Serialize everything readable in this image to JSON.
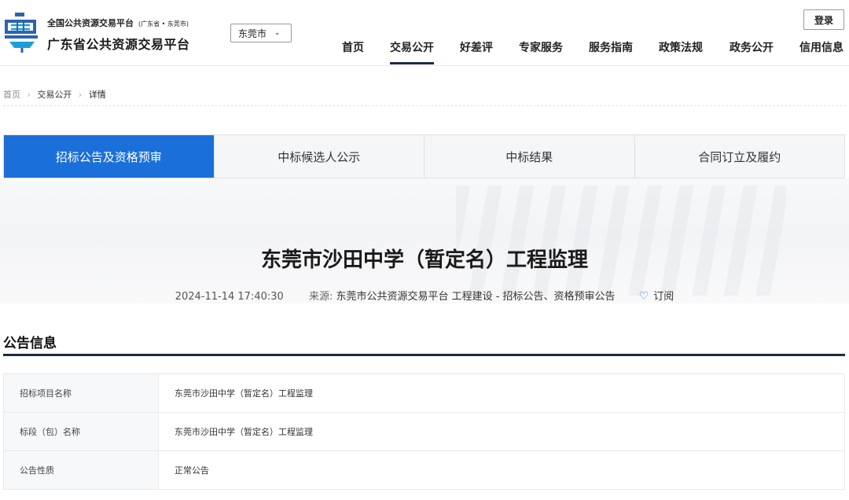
{
  "header": {
    "brand_top": "全国公共资源交易平台",
    "brand_top_sub": "(广东省 • 东莞市)",
    "brand_main": "广东省公共资源交易平台",
    "city_select": "东莞市",
    "login_label": "登录",
    "nav": [
      "首页",
      "交易公开",
      "好差评",
      "专家服务",
      "服务指南",
      "政策法规",
      "政务公开",
      "信用信息"
    ],
    "nav_active": "交易公开"
  },
  "breadcrumb": [
    "首页",
    "交易公开",
    "详情"
  ],
  "tabs": [
    "招标公告及资格预审",
    "中标候选人公示",
    "中标结果",
    "合同订立及履约"
  ],
  "tabs_active": "招标公告及资格预审",
  "article": {
    "title": "东莞市沙田中学（暂定名）工程监理",
    "datetime": "2024-11-14 17:40:30",
    "source_label": "来源:",
    "source": "东莞市公共资源交易平台 工程建设 - 招标公告、资格预审公告",
    "subscribe_label": "订阅"
  },
  "section": {
    "title": "公告信息",
    "rows": [
      {
        "label": "招标项目名称",
        "value": "东莞市沙田中学（暂定名）工程监理"
      },
      {
        "label": "标段（包）名称",
        "value": "东莞市沙田中学（暂定名）工程监理"
      },
      {
        "label": "公告性质",
        "value": "正常公告"
      }
    ]
  },
  "colors": {
    "accent": "#1a70d8",
    "dark_navy": "#1f2a44"
  },
  "icons": [
    "platform-logo-icon",
    "chevron-down-icon",
    "heart-icon"
  ]
}
